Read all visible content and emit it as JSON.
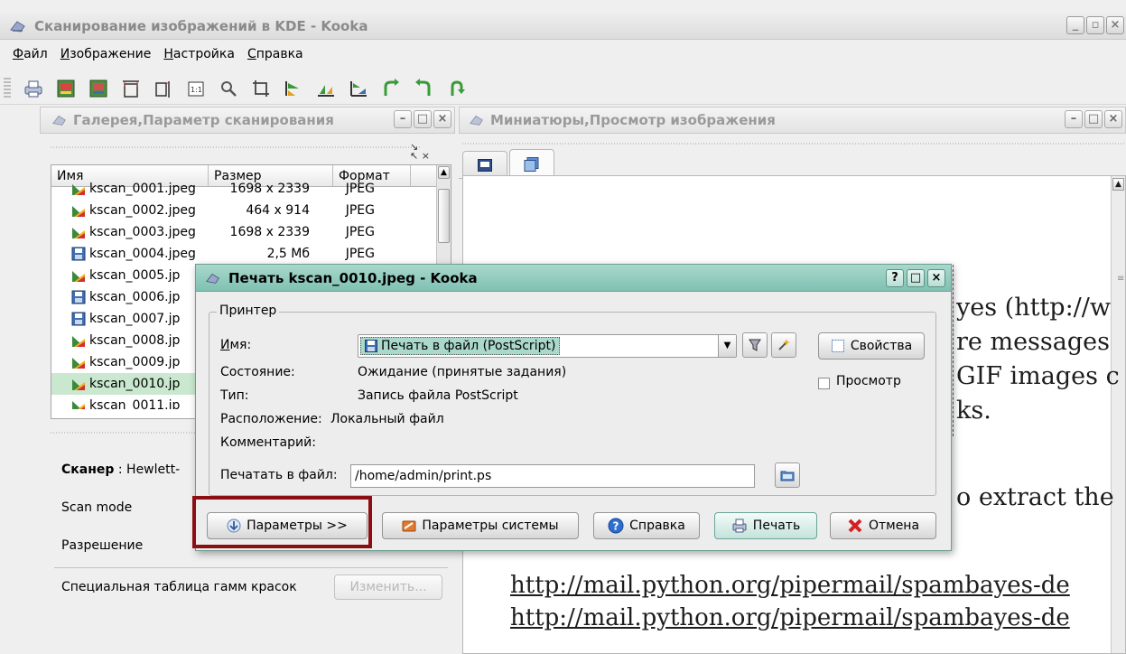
{
  "window": {
    "title": "Сканирование изображений в KDE - Kooka",
    "controls": [
      "_",
      "▫",
      "×"
    ]
  },
  "menu": [
    {
      "pre": "",
      "u": "Ф",
      "post": "айл"
    },
    {
      "pre": "",
      "u": "И",
      "post": "зображение"
    },
    {
      "pre": "",
      "u": "Н",
      "post": "астройка"
    },
    {
      "pre": "",
      "u": "С",
      "post": "правка"
    }
  ],
  "left_panel": {
    "title": "Галерея,Параметр сканирования",
    "columns": [
      "Имя",
      "Размер",
      "Формат"
    ],
    "files": [
      {
        "name": "kscan_0001.jpeg",
        "size": "1698 x 2339",
        "format": "JPEG",
        "icon": "image-icon"
      },
      {
        "name": "kscan_0002.jpeg",
        "size": "464 x 914",
        "format": "JPEG",
        "icon": "image-icon"
      },
      {
        "name": "kscan_0003.jpeg",
        "size": "1698 x 2339",
        "format": "JPEG",
        "icon": "image-icon"
      },
      {
        "name": "kscan_0004.jpeg",
        "size": "2,5 Мб",
        "format": "JPEG",
        "icon": "disk-icon"
      },
      {
        "name": "kscan_0005.jp",
        "size": "",
        "format": "",
        "icon": "image-icon"
      },
      {
        "name": "kscan_0006.jp",
        "size": "",
        "format": "",
        "icon": "disk-icon"
      },
      {
        "name": "kscan_0007.jp",
        "size": "",
        "format": "",
        "icon": "disk-icon"
      },
      {
        "name": "kscan_0008.jp",
        "size": "",
        "format": "",
        "icon": "image-icon"
      },
      {
        "name": "kscan_0009.jp",
        "size": "",
        "format": "",
        "icon": "image-icon"
      },
      {
        "name": "kscan_0010.jp",
        "size": "",
        "format": "",
        "icon": "image-icon",
        "selected": true
      },
      {
        "name": "kscan_0011.jp",
        "size": "",
        "format": "",
        "icon": "image-icon"
      }
    ],
    "scanner_label": "Сканер",
    "scanner_value": " : Hewlett-",
    "scan_mode_label": "Scan mode",
    "resolution_label": "Разрешение",
    "gamma_label": "Специальная таблица гамм красок",
    "gamma_button": "Изменить..."
  },
  "right_panel": {
    "title": "Миниатюры,Просмотр изображения",
    "doc_lines": [
      "yes (http://w",
      "re messages",
      "GIF images c",
      "ks.",
      "o extract the"
    ],
    "doc_links": [
      "http://mail.python.org/pipermail/spambayes-de",
      "http://mail.python.org/pipermail/spambayes-de"
    ]
  },
  "dialog": {
    "title": "Печать kscan_0010.jpeg - Kooka",
    "controls": [
      "?",
      "□",
      "×"
    ],
    "group_label": "Принтер",
    "name_label": "Имя:",
    "printer_value": "Печать в файл (PostScript)",
    "state_label": "Состояние:",
    "state_value": "Ожидание (принятые задания)",
    "type_label": "Тип:",
    "type_value": "Запись файла PostScript",
    "location_label": "Расположение:",
    "location_value": "Локальный файл",
    "comment_label": "Комментарий:",
    "print_to_file_label": "Печатать в файл:",
    "print_to_file_value": "/home/admin/print.ps",
    "properties_button": "Свойства",
    "preview_label": "Просмотр",
    "buttons": {
      "options": "Параметры >>",
      "system_options": "Параметры системы",
      "help": "Справка",
      "print": "Печать",
      "cancel": "Отмена"
    }
  }
}
